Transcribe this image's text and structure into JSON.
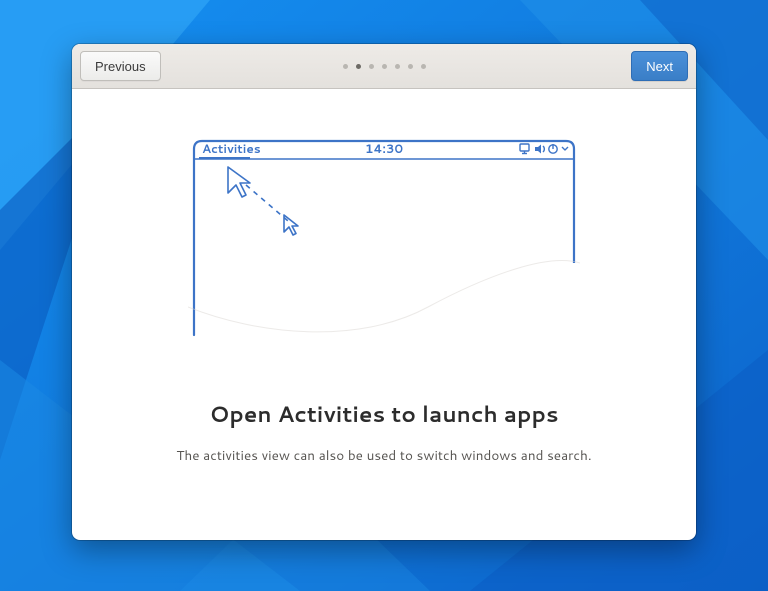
{
  "buttons": {
    "previous": "Previous",
    "next": "Next"
  },
  "pager": {
    "total": 7,
    "current_index": 1
  },
  "illustration": {
    "activities_label": "Activities",
    "clock": "14:30"
  },
  "copy": {
    "heading": "Open Activities to launch apps",
    "subheading": "The activities view can also be used to switch windows and search."
  },
  "colors": {
    "accent_blue": "#3d74c7",
    "suggested_button": "#4a90d9",
    "wallpaper_base": "#0d6fd8"
  }
}
